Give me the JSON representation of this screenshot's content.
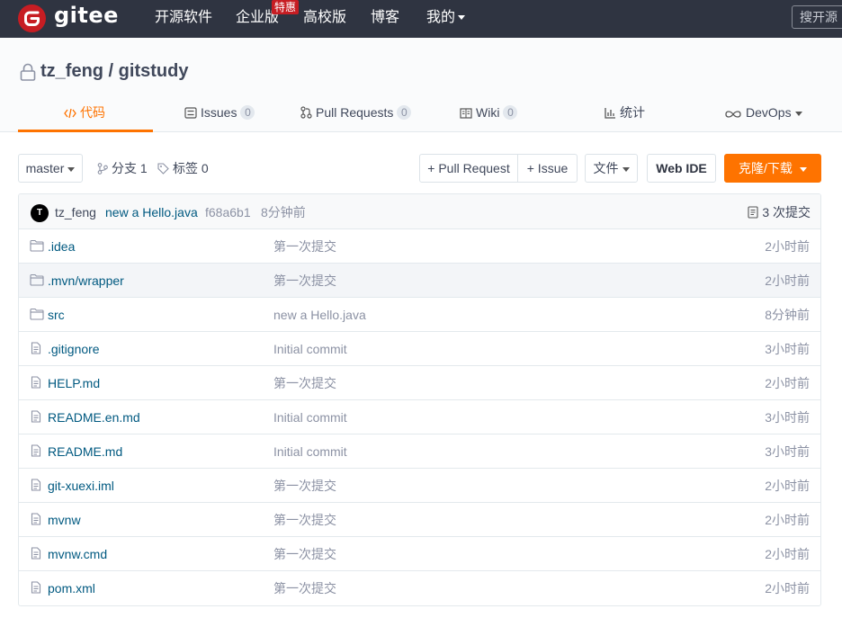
{
  "nav": {
    "logo_text": "gitee",
    "items": [
      "开源软件",
      "企业版",
      "高校版",
      "博客",
      "我的"
    ],
    "badge": "特惠",
    "search_placeholder": "搜开源"
  },
  "repo": {
    "title": "tz_feng / gitstudy",
    "tabs": [
      {
        "label": "代码",
        "icon": "code-icon",
        "active": true
      },
      {
        "label": "Issues",
        "count": "0",
        "icon": "issues-icon"
      },
      {
        "label": "Pull Requests",
        "count": "0",
        "icon": "pull-request-icon"
      },
      {
        "label": "Wiki",
        "count": "0",
        "icon": "wiki-icon"
      },
      {
        "label": "统计",
        "icon": "stats-icon"
      },
      {
        "label": "DevOps",
        "icon": "devops-icon"
      }
    ]
  },
  "toolbar": {
    "branch": "master",
    "branches": "分支 1",
    "tags": "标签 0",
    "pull_request": "+ Pull Request",
    "issue": "+ Issue",
    "file": "文件",
    "web_ide": "Web IDE",
    "clone": "克隆/下载"
  },
  "commit": {
    "author_initial": "T",
    "author": "tz_feng",
    "message": "new a Hello.java",
    "hash": "f68a6b1",
    "time": "8分钟前",
    "count": "3 次提交"
  },
  "files": [
    {
      "name": ".idea",
      "type": "folder",
      "message": "第一次提交",
      "time": "2小时前"
    },
    {
      "name": ".mvn/wrapper",
      "type": "folder",
      "message": "第一次提交",
      "time": "2小时前"
    },
    {
      "name": "src",
      "type": "folder",
      "message": "new a Hello.java",
      "time": "8分钟前"
    },
    {
      "name": ".gitignore",
      "type": "file",
      "message": "Initial commit",
      "time": "3小时前"
    },
    {
      "name": "HELP.md",
      "type": "file",
      "message": "第一次提交",
      "time": "2小时前"
    },
    {
      "name": "README.en.md",
      "type": "file",
      "message": "Initial commit",
      "time": "3小时前"
    },
    {
      "name": "README.md",
      "type": "file",
      "message": "Initial commit",
      "time": "3小时前"
    },
    {
      "name": "git-xuexi.iml",
      "type": "file",
      "message": "第一次提交",
      "time": "2小时前"
    },
    {
      "name": "mvnw",
      "type": "file",
      "message": "第一次提交",
      "time": "2小时前"
    },
    {
      "name": "mvnw.cmd",
      "type": "file",
      "message": "第一次提交",
      "time": "2小时前"
    },
    {
      "name": "pom.xml",
      "type": "file",
      "message": "第一次提交",
      "time": "2小时前"
    }
  ],
  "colors": {
    "brand": "#c71d23",
    "accent": "#fe7300",
    "nav_bg": "#2f3441",
    "link": "#005980"
  }
}
